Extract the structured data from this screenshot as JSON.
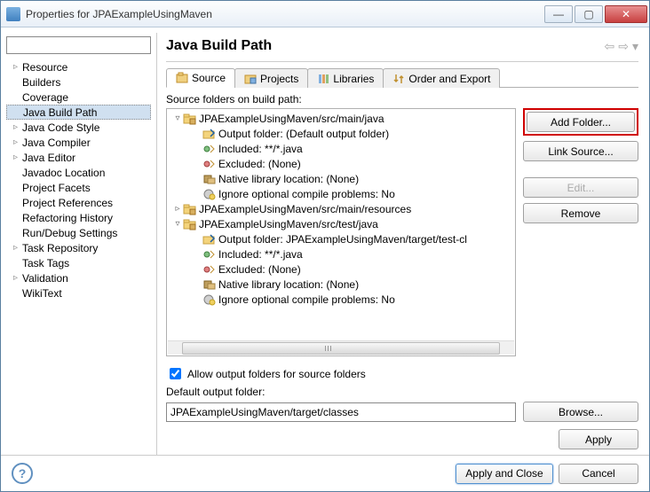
{
  "window": {
    "title": "Properties for JPAExampleUsingMaven"
  },
  "sidebar": {
    "items": [
      {
        "label": "Resource",
        "expandable": true
      },
      {
        "label": "Builders",
        "expandable": false
      },
      {
        "label": "Coverage",
        "expandable": false
      },
      {
        "label": "Java Build Path",
        "expandable": false,
        "selected": true
      },
      {
        "label": "Java Code Style",
        "expandable": true
      },
      {
        "label": "Java Compiler",
        "expandable": true
      },
      {
        "label": "Java Editor",
        "expandable": true
      },
      {
        "label": "Javadoc Location",
        "expandable": false
      },
      {
        "label": "Project Facets",
        "expandable": false
      },
      {
        "label": "Project References",
        "expandable": false
      },
      {
        "label": "Refactoring History",
        "expandable": false
      },
      {
        "label": "Run/Debug Settings",
        "expandable": false
      },
      {
        "label": "Task Repository",
        "expandable": true
      },
      {
        "label": "Task Tags",
        "expandable": false
      },
      {
        "label": "Validation",
        "expandable": true
      },
      {
        "label": "WikiText",
        "expandable": false
      }
    ]
  },
  "header": {
    "title": "Java Build Path"
  },
  "tabs": [
    {
      "label": "Source",
      "active": true,
      "icon": "source"
    },
    {
      "label": "Projects",
      "active": false,
      "icon": "projects"
    },
    {
      "label": "Libraries",
      "active": false,
      "icon": "libraries"
    },
    {
      "label": "Order and Export",
      "active": false,
      "icon": "order"
    }
  ],
  "source_section": {
    "caption": "Source folders on build path:",
    "nodes": [
      {
        "depth": 0,
        "exp": "▿",
        "icon": "pkg",
        "label": "JPAExampleUsingMaven/src/main/java"
      },
      {
        "depth": 1,
        "exp": "",
        "icon": "out",
        "label": "Output folder: (Default output folder)"
      },
      {
        "depth": 1,
        "exp": "",
        "icon": "inc",
        "label": "Included: **/*.java"
      },
      {
        "depth": 1,
        "exp": "",
        "icon": "exc",
        "label": "Excluded: (None)"
      },
      {
        "depth": 1,
        "exp": "",
        "icon": "nat",
        "label": "Native library location: (None)"
      },
      {
        "depth": 1,
        "exp": "",
        "icon": "ign",
        "label": "Ignore optional compile problems: No"
      },
      {
        "depth": 0,
        "exp": "▹",
        "icon": "pkg",
        "label": "JPAExampleUsingMaven/src/main/resources"
      },
      {
        "depth": 0,
        "exp": "▿",
        "icon": "pkg",
        "label": "JPAExampleUsingMaven/src/test/java"
      },
      {
        "depth": 1,
        "exp": "",
        "icon": "out",
        "label": "Output folder: JPAExampleUsingMaven/target/test-cl"
      },
      {
        "depth": 1,
        "exp": "",
        "icon": "inc",
        "label": "Included: **/*.java"
      },
      {
        "depth": 1,
        "exp": "",
        "icon": "exc",
        "label": "Excluded: (None)"
      },
      {
        "depth": 1,
        "exp": "",
        "icon": "nat",
        "label": "Native library location: (None)"
      },
      {
        "depth": 1,
        "exp": "",
        "icon": "ign",
        "label": "Ignore optional compile problems: No"
      }
    ],
    "allow_output_checkbox_label": "Allow output folders for source folders",
    "allow_output_checked": true,
    "default_output_label": "Default output folder:",
    "default_output_value": "JPAExampleUsingMaven/target/classes"
  },
  "buttons": {
    "add_folder": "Add Folder...",
    "link_source": "Link Source...",
    "edit": "Edit...",
    "remove": "Remove",
    "browse": "Browse...",
    "apply": "Apply",
    "apply_close": "Apply and Close",
    "cancel": "Cancel"
  }
}
